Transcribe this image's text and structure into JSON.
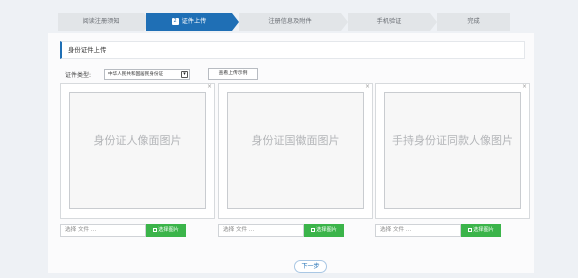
{
  "steps": [
    {
      "label": "阅读注册须知",
      "number": "",
      "active": false
    },
    {
      "label": "证件上传",
      "number": "2",
      "active": true
    },
    {
      "label": "注册信息及附件",
      "number": "",
      "active": false
    },
    {
      "label": "手机验证",
      "number": "",
      "active": false
    },
    {
      "label": "完成",
      "number": "",
      "active": false
    }
  ],
  "section": {
    "title": "身份证件上传"
  },
  "document_type": {
    "label": "证件类型:",
    "selected": "中华人民共和国居民身份证"
  },
  "example_button": "查看上传示例",
  "uploads": [
    {
      "placeholder": "身份证人像面图片",
      "file_placeholder": "选择 文件 ...",
      "button": "选择图片",
      "close": "×"
    },
    {
      "placeholder": "身份证国徽面图片",
      "file_placeholder": "选择 文件 ...",
      "button": "选择图片",
      "close": "×"
    },
    {
      "placeholder": "手持身份证同款人像图片",
      "file_placeholder": "选择 文件 ...",
      "button": "选择图片",
      "close": "×"
    }
  ],
  "next_button": "下一步",
  "colors": {
    "accent": "#1f6fb5",
    "green": "#3bb44a",
    "step_inactive": "#e2e5e8"
  }
}
